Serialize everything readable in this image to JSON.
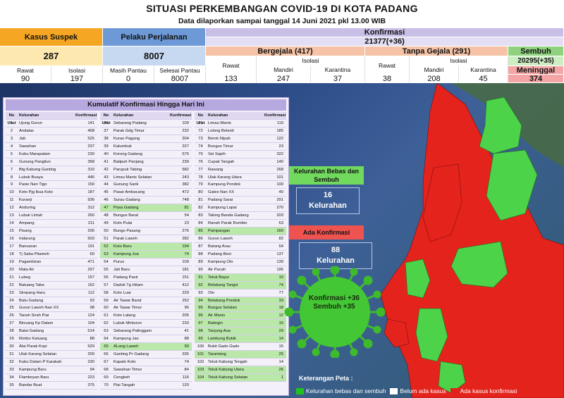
{
  "header": {
    "title": "SITUASI PERKEMBANGAN COVID-19 DI KOTA PADANG",
    "subtitle": "Data dilaporkan sampai tanggal 14 Juni 2021 pkl 13.00 WIB"
  },
  "stats": {
    "suspek": {
      "label": "Kasus Suspek",
      "value": "287",
      "rawat_label": "Rawat",
      "rawat": "90",
      "isolasi_label": "Isolasi",
      "isolasi": "197"
    },
    "perjalanan": {
      "label": "Pelaku Perjalanan",
      "value": "8007",
      "masih_label": "Masih Pantau",
      "masih": "0",
      "selesai_label": "Selesai Pantau",
      "selesai": "8007"
    },
    "konfirmasi": {
      "label": "Konfirmasi",
      "value": "21377(+36)"
    },
    "bergejala": {
      "label": "Bergejala (417)",
      "rawat_label": "Rawat",
      "rawat": "133",
      "isolasi_label": "Isolasi",
      "mandiri_label": "Mandiri",
      "mandiri": "247",
      "karantina_label": "Karantina",
      "karantina": "37"
    },
    "tanpa_gejala": {
      "label": "Tanpa Gejala (291)",
      "rawat_label": "Rawat",
      "rawat": "38",
      "isolasi_label": "Isolasi",
      "mandiri_label": "Mandiri",
      "mandiri": "208",
      "karantina_label": "Karantina",
      "karantina": "45"
    },
    "sembuh": {
      "label": "Sembuh",
      "value": "20295(+35)"
    },
    "meninggal": {
      "label": "Meninggal",
      "value": "374"
    }
  },
  "table": {
    "title": "Kumulatif Konfirmasi Hingga Hari Ini",
    "head_no": "No Urut",
    "head_kel": "Kelurahan",
    "head_konf": "Konfirmasi"
  },
  "rows": [
    [
      "1",
      "Ujung Gurun",
      "141",
      false
    ],
    [
      "2",
      "Andalas",
      "468",
      false
    ],
    [
      "3",
      "Jati",
      "525",
      false
    ],
    [
      "4",
      "Sawahan",
      "237",
      false
    ],
    [
      "5",
      "Kubu Marapalam",
      "230",
      false
    ],
    [
      "6",
      "Gunung Pangilun",
      "358",
      false
    ],
    [
      "7",
      "Btg Kabung Ganting",
      "310",
      false
    ],
    [
      "8",
      "Lubuk Buaya",
      "446",
      false
    ],
    [
      "9",
      "Pasie Nan Tigo",
      "150",
      false
    ],
    [
      "10",
      "Koto Pjg Ikua Koto",
      "187",
      false
    ],
    [
      "11",
      "Kuranji",
      "936",
      false
    ],
    [
      "12",
      "Anduring",
      "312",
      false
    ],
    [
      "13",
      "Lubuk Lintah",
      "260",
      false
    ],
    [
      "14",
      "Ampang",
      "211",
      false
    ],
    [
      "15",
      "Pisang",
      "206",
      false
    ],
    [
      "16",
      "Indarung",
      "503",
      false
    ],
    [
      "17",
      "Banuaran",
      "191",
      false
    ],
    [
      "18",
      "Tj Saba Pitameh",
      "60",
      false
    ],
    [
      "19",
      "Pagambiran",
      "471",
      false
    ],
    [
      "20",
      "Mata Air",
      "297",
      false
    ],
    [
      "21",
      "Lubeg",
      "157",
      false
    ],
    [
      "22",
      "Batuang Taba",
      "162",
      false
    ],
    [
      "23",
      "Simpang Haru",
      "112",
      false
    ],
    [
      "24",
      "Batu Gadang",
      "93",
      false
    ],
    [
      "25",
      "Gurun Laweh Nan XX",
      "98",
      false
    ],
    [
      "26",
      "Tanah Sirah Piai",
      "124",
      false
    ],
    [
      "27",
      "Binuang Kp Dalam",
      "104",
      false
    ],
    [
      "28",
      "Balai Gadang",
      "514",
      false
    ],
    [
      "29",
      "Rimbo Kaluang",
      "88",
      false
    ],
    [
      "30",
      "Alai Parak Kopi",
      "529",
      false
    ],
    [
      "31",
      "Ulak Karang Selatan",
      "200",
      false
    ],
    [
      "32",
      "Kubu Dalam P Karakah",
      "230",
      false
    ],
    [
      "33",
      "Kampung Baru",
      "94",
      false
    ],
    [
      "34",
      "Flamboyan Baru",
      "223",
      false
    ],
    [
      "35",
      "Bandar Buat",
      "375",
      false
    ],
    [
      "36",
      "Sebarang Padang",
      "109",
      false
    ],
    [
      "37",
      "Parak Gdg Timur",
      "232",
      false
    ],
    [
      "38",
      "Kurao Pagang",
      "304",
      false
    ],
    [
      "39",
      "Kalumbuk",
      "227",
      false
    ],
    [
      "40",
      "Korong Gadang",
      "575",
      false
    ],
    [
      "41",
      "Batipuh Panjang",
      "239",
      false
    ],
    [
      "42",
      "Parupuk Tabing",
      "582",
      false
    ],
    [
      "43",
      "Limau Manis Selatan",
      "243",
      false
    ],
    [
      "44",
      "Gunung Sarik",
      "382",
      false
    ],
    [
      "45",
      "Pasar Ambacang",
      "472",
      false
    ],
    [
      "46",
      "Surau Gadang",
      "748",
      false
    ],
    [
      "47",
      "Pasa Gadang",
      "81",
      true
    ],
    [
      "48",
      "Bungus Barat",
      "54",
      false
    ],
    [
      "49",
      "Koto Pulai",
      "23",
      false
    ],
    [
      "50",
      "Bungo Pasang",
      "276",
      false
    ],
    [
      "51",
      "Parak Laweh",
      "282",
      false
    ],
    [
      "52",
      "Koto Baru",
      "194",
      true
    ],
    [
      "53",
      "Kampung Jua",
      "74",
      true
    ],
    [
      "54",
      "Purus",
      "109",
      false
    ],
    [
      "55",
      "Jati Baru",
      "181",
      false
    ],
    [
      "56",
      "Padang Pasir",
      "151",
      false
    ],
    [
      "57",
      "Dadok Tg Hitam",
      "412",
      false
    ],
    [
      "58",
      "Koto Luar",
      "229",
      false
    ],
    [
      "59",
      "Air Tawar Barat",
      "252",
      false
    ],
    [
      "60",
      "Air Tawar Timur",
      "96",
      false
    ],
    [
      "61",
      "Koto Lalang",
      "205",
      false
    ],
    [
      "62",
      "Lubuk Minturun",
      "233",
      false
    ],
    [
      "63",
      "Sebarang Palinggam",
      "41",
      false
    ],
    [
      "64",
      "Kampung Jao",
      "88",
      false
    ],
    [
      "65",
      "ALang Laweh",
      "90",
      true
    ],
    [
      "66",
      "Ganting Pr Gadang",
      "335",
      false
    ],
    [
      "67",
      "Kapalo Koto",
      "74",
      false
    ],
    [
      "68",
      "Sawahan Timur",
      "84",
      false
    ],
    [
      "69",
      "Cengkeh",
      "116",
      false
    ],
    [
      "70",
      "Piai Tangah",
      "120",
      false
    ],
    [
      "71",
      "Limau Manis",
      "119",
      false
    ],
    [
      "72",
      "Lolong Belanti",
      "185",
      false
    ],
    [
      "73",
      "Berok Nipah",
      "122",
      false
    ],
    [
      "74",
      "Bungus Timur",
      "23",
      false
    ],
    [
      "75",
      "Sei Sapih",
      "322",
      false
    ],
    [
      "76",
      "Cupak Tangah",
      "140",
      false
    ],
    [
      "77",
      "Rawang",
      "268",
      false
    ],
    [
      "78",
      "Ulak Karang Utara",
      "101",
      false
    ],
    [
      "79",
      "Kampung Pondok",
      "100",
      false
    ],
    [
      "80",
      "Gates Nan XX",
      "40",
      false
    ],
    [
      "81",
      "Padang Sarai",
      "291",
      false
    ],
    [
      "82",
      "Kampung Lapai",
      "270",
      false
    ],
    [
      "83",
      "Tabing Banda Gadang",
      "203",
      false
    ],
    [
      "84",
      "Ranah Parak Rumbio",
      "63",
      false
    ],
    [
      "85",
      "Pampangan",
      "160",
      true
    ],
    [
      "86",
      "Gurun Laweh",
      "82",
      false
    ],
    [
      "87",
      "Batang Arau",
      "54",
      false
    ],
    [
      "88",
      "Padang Besi",
      "137",
      false
    ],
    [
      "89",
      "Kampung Olo",
      "139",
      false
    ],
    [
      "90",
      "Air Pacah",
      "195",
      false
    ],
    [
      "91",
      "Teluk Bayur",
      "10",
      true
    ],
    [
      "92",
      "Belakang Tangsi",
      "74",
      true
    ],
    [
      "93",
      "Olo",
      "77",
      false
    ],
    [
      "94",
      "Belakang Pondok",
      "33",
      true
    ],
    [
      "95",
      "Bungus Selatan",
      "18",
      true
    ],
    [
      "96",
      "Air Manis",
      "12",
      true
    ],
    [
      "97",
      "Batingin",
      "10",
      true
    ],
    [
      "98",
      "Tanjung Aua",
      "29",
      true
    ],
    [
      "99",
      "Lambung Bukik",
      "14",
      true
    ],
    [
      "100",
      "Bukit Gado Gado",
      "15",
      false
    ],
    [
      "101",
      "Tarantang",
      "25",
      true
    ],
    [
      "102",
      "Teluk Kabung Tengah",
      "14",
      false
    ],
    [
      "103",
      "Teluk Kabung Utara",
      "26",
      true
    ],
    [
      "104",
      "Teluk Kabung Selatan",
      "1",
      true
    ]
  ],
  "map": {
    "free_label": "Kelurahan Bebas dan Sembuh",
    "free_count": "16",
    "free_unit": "Kelurahan",
    "red_label": "Ada Konfirmasi",
    "red_count": "88",
    "red_unit": "Kelurahan",
    "virus_line1": "Konfirmasi +36",
    "virus_line2": "Sembuh +35"
  },
  "legend": {
    "title": "Keterangan Peta :",
    "green": "Kelurahan bebas dan sembuh",
    "white": "Belum ada kasus",
    "red": "Ada kasus konfirmasi",
    "green_color": "#22c21e",
    "white_color": "#ffffff",
    "red_color": "#e1201c"
  }
}
